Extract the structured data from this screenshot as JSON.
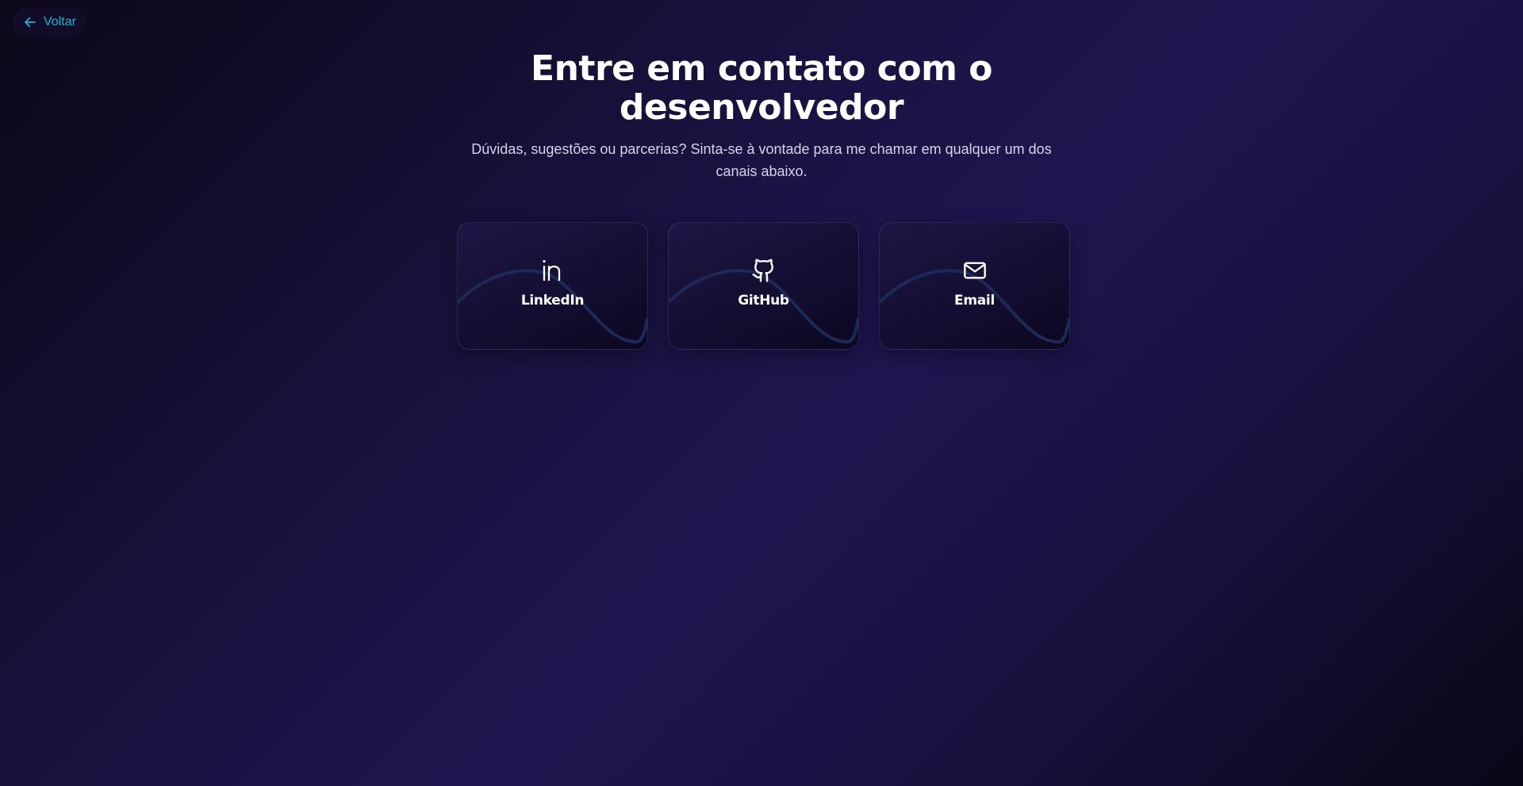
{
  "back": {
    "label": "Voltar",
    "icon": "arrow-left-icon"
  },
  "header": {
    "title": "Entre em contato com o desenvolvedor",
    "subtitle": "Dúvidas, sugestões ou parcerias? Sinta-se à vontade para me chamar em qualquer um dos canais abaixo."
  },
  "cards": [
    {
      "label": "LinkedIn",
      "icon": "linkedin-icon"
    },
    {
      "label": "GitHub",
      "icon": "github-icon"
    },
    {
      "label": "Email",
      "icon": "mail-icon"
    }
  ],
  "colors": {
    "accent": "#1fb6d6",
    "background_mid": "#1f1650",
    "background_dark": "#0a0616",
    "text": "#ffffff",
    "muted_text": "#d7d3e8",
    "wave": "#1c2a5a"
  }
}
